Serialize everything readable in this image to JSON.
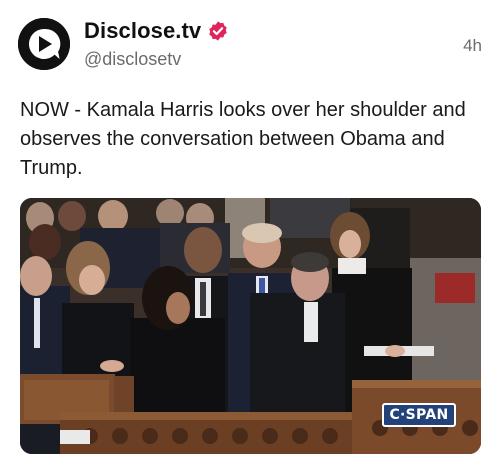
{
  "post": {
    "author": {
      "display_name": "Disclose.tv",
      "handle": "@disclosetv",
      "verified": true,
      "avatar_icon": "play-bubble-logo-icon"
    },
    "time": "4h",
    "text": "NOW - Kamala Harris looks over her shoulder and observes the conversation between Obama and Trump.",
    "media": {
      "watermark": "C·SPAN"
    }
  },
  "colors": {
    "verified_badge": "#e0245e",
    "text": "#1a1a1a",
    "secondary_text": "#6b6b6b",
    "cspan_blue": "#24427a"
  }
}
